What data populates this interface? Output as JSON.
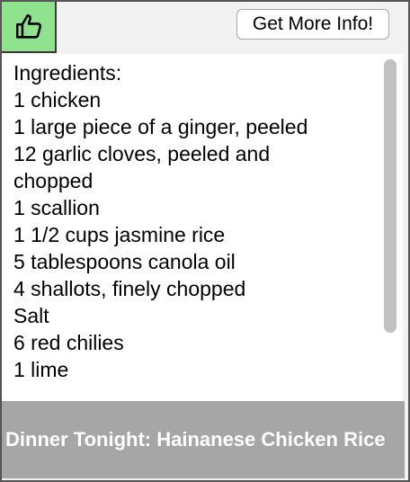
{
  "like_button": {
    "icon": "thumbs-up-icon",
    "color": "#8fe38f"
  },
  "info_button": {
    "label": "Get More Info!"
  },
  "recipe": {
    "heading": "Ingredients:",
    "ingredients": [
      "1 chicken",
      "1 large piece of a ginger, peeled",
      "12 garlic cloves, peeled and chopped",
      "1 scallion",
      "1 1/2 cups jasmine rice",
      "5 tablespoons canola oil",
      "4 shallots, finely chopped",
      "Salt",
      "6 red chilies",
      "1 lime"
    ]
  },
  "footer": {
    "title": "Dinner Tonight: Hainanese Chicken Rice",
    "background": "#a6a6a6"
  }
}
